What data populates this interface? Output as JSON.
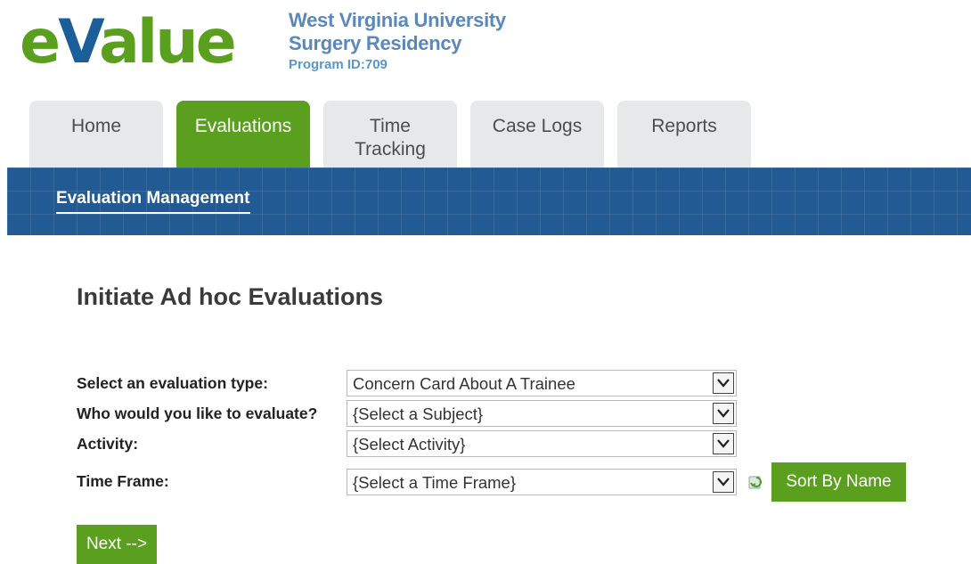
{
  "header": {
    "logo": {
      "e": "e",
      "v": "V",
      "alue": "alue"
    },
    "org_line1": "West Virginia University",
    "org_line2": "Surgery Residency",
    "program_id": "Program ID:709"
  },
  "tabs": [
    {
      "label": "Home",
      "active": false
    },
    {
      "label": "Evaluations",
      "active": true
    },
    {
      "label": "Time\nTracking",
      "active": false
    },
    {
      "label": "Case Logs",
      "active": false
    },
    {
      "label": "Reports",
      "active": false
    }
  ],
  "subnav": {
    "item": "Evaluation Management"
  },
  "page": {
    "title": "Initiate Ad hoc Evaluations",
    "fields": [
      {
        "label": "Select an evaluation type:",
        "value": "Concern Card About A Trainee"
      },
      {
        "label": "Who would you like to evaluate?",
        "value": "{Select a Subject}"
      },
      {
        "label": "Activity:",
        "value": "{Select Activity}"
      },
      {
        "label": "Time Frame:",
        "value": "{Select a Time Frame}"
      }
    ],
    "sort_button": "Sort By Name",
    "next_button": "Next -->"
  },
  "colors": {
    "brand_green": "#5aa01e",
    "brand_blue": "#225a93",
    "org_blue": "#5b88ba"
  }
}
